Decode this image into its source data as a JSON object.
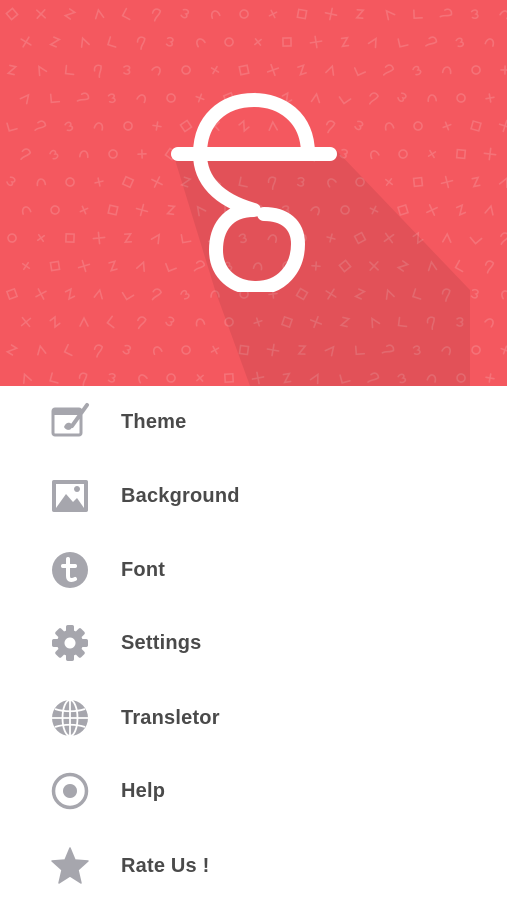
{
  "header": {
    "logo_icon": "gurmukhi-letter-logo-icon",
    "background_color": "#f4585f",
    "pattern_icon": "alphabet-pattern-icon"
  },
  "menu": {
    "items": [
      {
        "label": "Theme",
        "icon": "theme-icon"
      },
      {
        "label": "Background",
        "icon": "image-icon"
      },
      {
        "label": "Font",
        "icon": "font-icon"
      },
      {
        "label": "Settings",
        "icon": "gear-icon"
      },
      {
        "label": "Transletor",
        "icon": "globe-icon"
      },
      {
        "label": "Help",
        "icon": "help-icon"
      },
      {
        "label": "Rate Us !",
        "icon": "star-icon"
      }
    ],
    "icon_color": "#a6a6ad",
    "label_color": "#4a4a4a"
  }
}
